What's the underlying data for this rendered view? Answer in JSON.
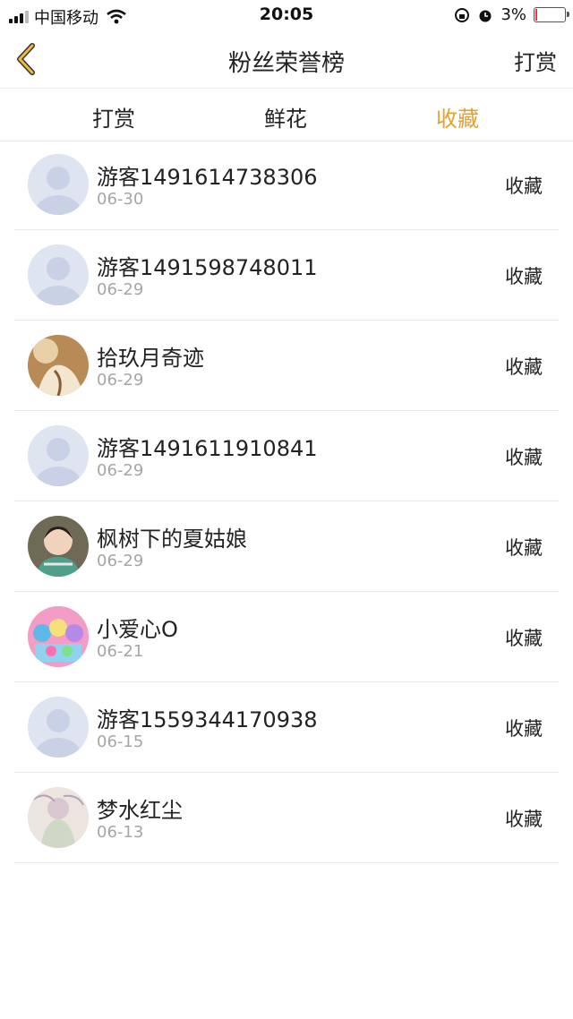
{
  "status_bar": {
    "carrier": "中国移动",
    "time": "20:05",
    "battery": "3%"
  },
  "nav": {
    "title": "粉丝荣誉榜",
    "action": "打赏"
  },
  "tabs": [
    {
      "label": "打赏",
      "active": false
    },
    {
      "label": "鲜花",
      "active": false
    },
    {
      "label": "收藏",
      "active": true
    }
  ],
  "accent_color": "#e6a12a",
  "fans": [
    {
      "name": "游客1491614738306",
      "date": "06-30",
      "action": "收藏",
      "avatar": "default"
    },
    {
      "name": "游客1491598748011",
      "date": "06-29",
      "action": "收藏",
      "avatar": "default"
    },
    {
      "name": "拾玖月奇迹",
      "date": "06-29",
      "action": "收藏",
      "avatar": "photo-sepia"
    },
    {
      "name": "游客1491611910841",
      "date": "06-29",
      "action": "收藏",
      "avatar": "default"
    },
    {
      "name": "枫树下的夏姑娘",
      "date": "06-29",
      "action": "收藏",
      "avatar": "photo-child"
    },
    {
      "name": "小爱心O",
      "date": "06-21",
      "action": "收藏",
      "avatar": "photo-anime"
    },
    {
      "name": "游客1559344170938",
      "date": "06-15",
      "action": "收藏",
      "avatar": "default"
    },
    {
      "name": "梦水红尘",
      "date": "06-13",
      "action": "收藏",
      "avatar": "photo-sketch"
    }
  ]
}
